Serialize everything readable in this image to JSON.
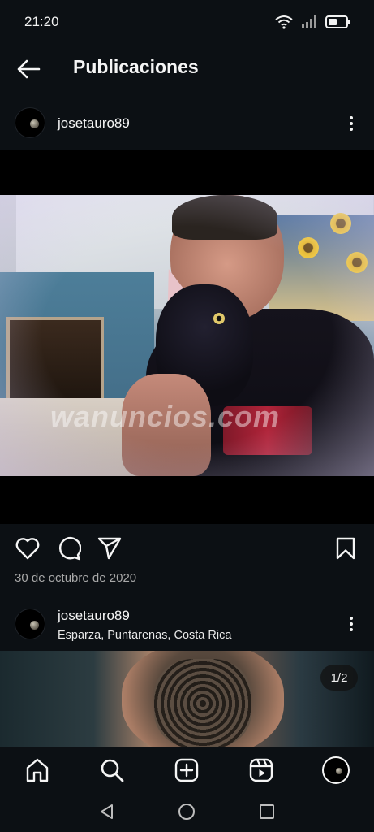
{
  "status_bar": {
    "time": "21:20",
    "icons": [
      "wifi-icon",
      "signal-icon",
      "battery-icon"
    ]
  },
  "header": {
    "back_icon": "arrow-left-icon",
    "title": "Publicaciones"
  },
  "post1": {
    "username": "josetauro89",
    "more_icon": "more-vertical-icon",
    "watermark": "wanuncios.com",
    "actions": [
      "heart-icon",
      "comment-icon",
      "share-icon",
      "bookmark-icon"
    ],
    "date": "30 de octubre de 2020"
  },
  "post2": {
    "username": "josetauro89",
    "location": "Esparza, Puntarenas, Costa Rica",
    "more_icon": "more-vertical-icon",
    "carousel_counter": "1/2"
  },
  "bottom_nav": {
    "items": [
      "home-icon",
      "search-icon",
      "add-post-icon",
      "reels-icon",
      "profile-avatar"
    ]
  },
  "system_nav": {
    "items": [
      "back-triangle-icon",
      "home-circle-icon",
      "recents-square-icon"
    ]
  },
  "colors": {
    "background": "#0c1014",
    "text": "#f5f5f5",
    "muted_text": "#a8a8a8"
  }
}
